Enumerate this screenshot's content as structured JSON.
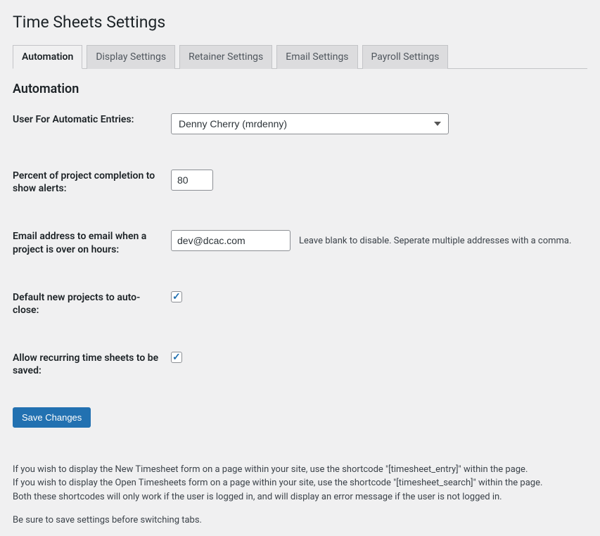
{
  "page_title": "Time Sheets Settings",
  "tabs": [
    {
      "label": "Automation",
      "active": true
    },
    {
      "label": "Display Settings",
      "active": false
    },
    {
      "label": "Retainer Settings",
      "active": false
    },
    {
      "label": "Email Settings",
      "active": false
    },
    {
      "label": "Payroll Settings",
      "active": false
    }
  ],
  "section_title": "Automation",
  "fields": {
    "user_entries": {
      "label": "User For Automatic Entries:",
      "value": "Denny Cherry (mrdenny)"
    },
    "percent_alert": {
      "label": "Percent of project completion to show alerts:",
      "value": "80"
    },
    "email_over": {
      "label": "Email address to email when a project is over on hours:",
      "value": "dev@dcac.com",
      "hint": "Leave blank to disable. Seperate multiple addresses with a comma."
    },
    "auto_close": {
      "label": "Default new projects to auto-close:",
      "checked": true
    },
    "recurring": {
      "label": "Allow recurring time sheets to be saved:",
      "checked": true
    }
  },
  "save_button": "Save Changes",
  "footer": {
    "line1": "If you wish to display the New Timesheet form on a page within your site, use the shortcode \"[timesheet_entry]\" within the page.",
    "line2": "If you wish to display the Open Timesheets form on a page within your site, use the shortcode \"[timesheet_search]\" within the page.",
    "line3": "Both these shortcodes will only work if the user is logged in, and will display an error message if the user is not logged in.",
    "line4": "Be sure to save settings before switching tabs."
  }
}
